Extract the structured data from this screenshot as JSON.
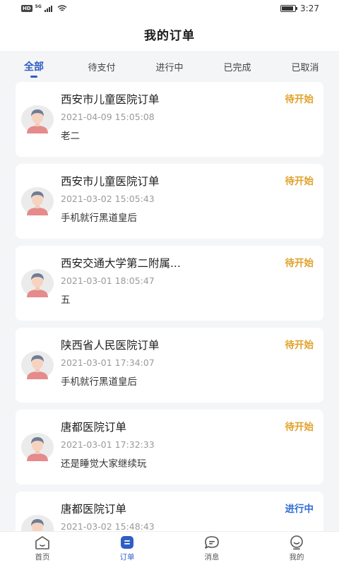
{
  "status_bar": {
    "left_badge": "HD",
    "network": "5G",
    "time": "3:27",
    "battery_level": 0.9
  },
  "header": {
    "title": "我的订单"
  },
  "tabs": [
    {
      "label": "全部",
      "active": true
    },
    {
      "label": "待支付",
      "active": false
    },
    {
      "label": "进行中",
      "active": false
    },
    {
      "label": "已完成",
      "active": false
    },
    {
      "label": "已取消",
      "active": false
    }
  ],
  "colors": {
    "accent": "#2f5ec4",
    "status_pending": "#e0a12a",
    "status_in_progress": "#2f6bd6"
  },
  "orders": [
    {
      "title": "西安市儿童医院订单",
      "time": "2021-04-09 15:05:08",
      "name": "老二",
      "status": "待开始",
      "status_type": "pending"
    },
    {
      "title": "西安市儿童医院订单",
      "time": "2021-03-02 15:05:43",
      "name": "手机就行黑道皇后",
      "status": "待开始",
      "status_type": "pending"
    },
    {
      "title": "西安交通大学第二附属...",
      "time": "2021-03-01 18:05:47",
      "name": "五",
      "status": "待开始",
      "status_type": "pending"
    },
    {
      "title": "陕西省人民医院订单",
      "time": "2021-03-01 17:34:07",
      "name": "手机就行黑道皇后",
      "status": "待开始",
      "status_type": "pending"
    },
    {
      "title": "唐都医院订单",
      "time": "2021-03-01 17:32:33",
      "name": "还是睡觉大家继续玩",
      "status": "待开始",
      "status_type": "pending"
    },
    {
      "title": "唐都医院订单",
      "time": "2021-03-02 15:48:43",
      "name": "",
      "status": "进行中",
      "status_type": "in_progress"
    }
  ],
  "bottom_nav": [
    {
      "label": "首页",
      "icon": "home-icon",
      "active": false
    },
    {
      "label": "订单",
      "icon": "order-icon",
      "active": true
    },
    {
      "label": "消息",
      "icon": "message-icon",
      "active": false
    },
    {
      "label": "我的",
      "icon": "profile-icon",
      "active": false
    }
  ]
}
